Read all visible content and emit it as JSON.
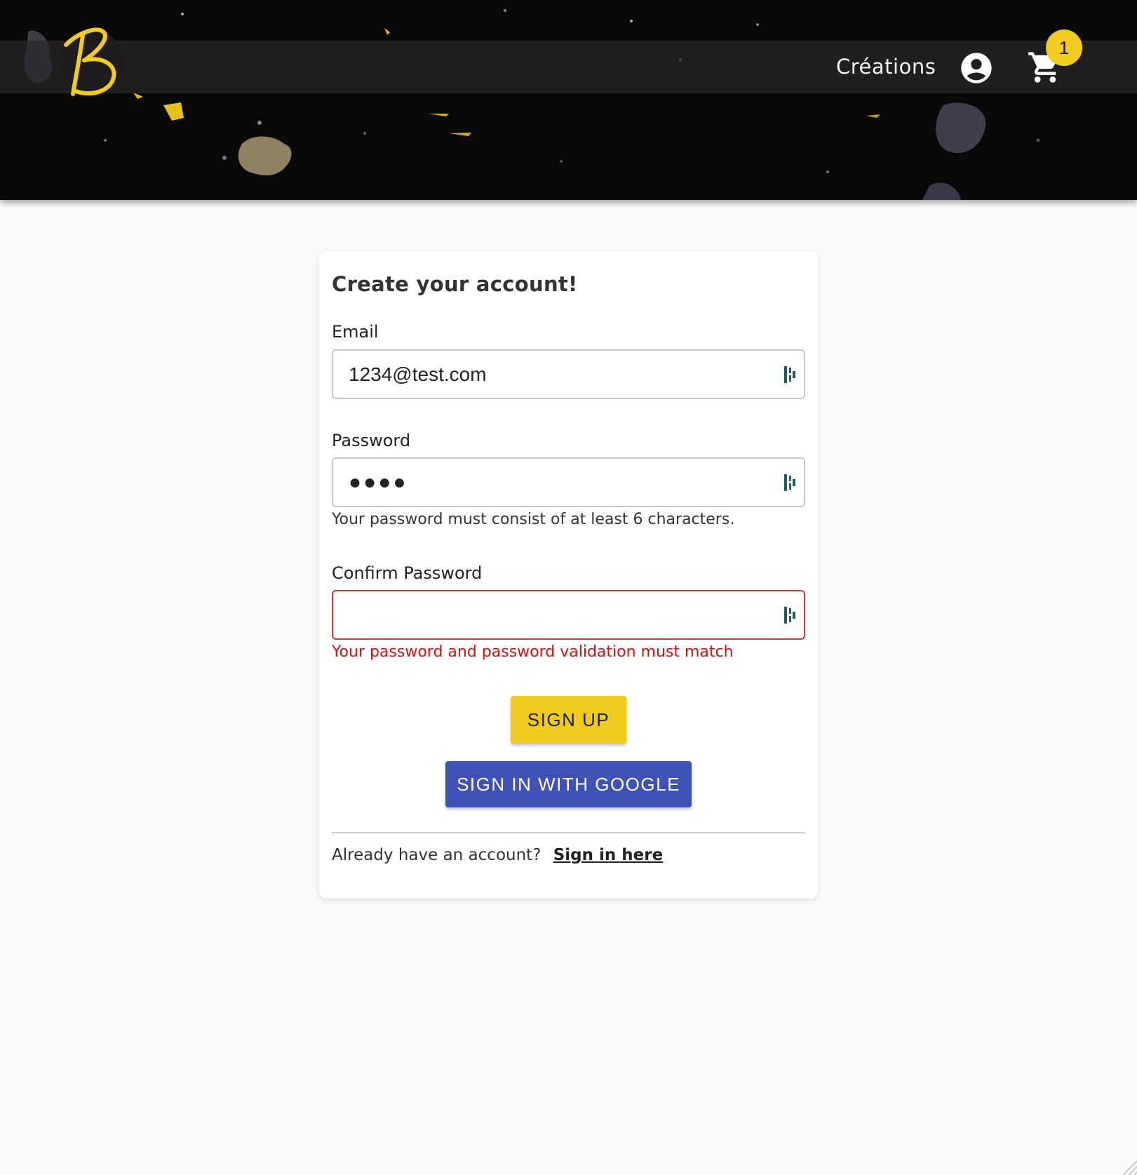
{
  "nav": {
    "logo_alt": "B",
    "creations_label": "Créations",
    "cart_count": "1"
  },
  "form": {
    "title": "Create your account!",
    "email": {
      "label": "Email",
      "value": "1234@test.com"
    },
    "password": {
      "label": "Password",
      "masked_value": "●●●●",
      "helper": "Your password must consist of at least 6 characters."
    },
    "confirm_password": {
      "label": "Confirm Password",
      "value": "",
      "error": "Your password and password validation must match"
    },
    "signup_label": "SIGN UP",
    "google_label": "SIGN IN WITH GOOGLE",
    "footer_text": "Already have an account?",
    "signin_link": "Sign in here"
  },
  "colors": {
    "accent_yellow": "#efca1f",
    "google_blue": "#3f51b5",
    "error_red": "#d93636",
    "header_bg": "#0a0909"
  },
  "icons": [
    "logo-b-icon",
    "account-circle-icon",
    "shopping-cart-icon",
    "password-manager-icon"
  ]
}
